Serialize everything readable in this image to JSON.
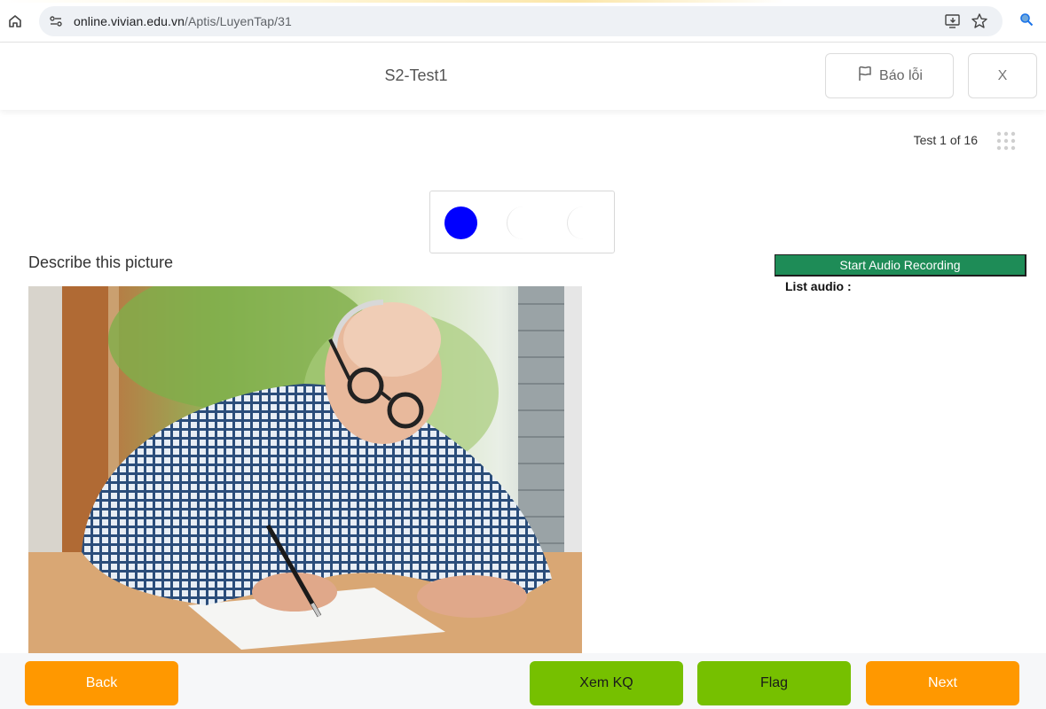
{
  "browser": {
    "url_host": "online.vivian.edu.vn",
    "url_path": "/Aptis/LuyenTap/31"
  },
  "header": {
    "title": "S2-Test1",
    "report_label": "Báo lỗi",
    "close_label": "X"
  },
  "test": {
    "counter_text": "Test 1 of 16"
  },
  "progress": {
    "total_dots": 3,
    "active_index": 0,
    "active_color": "#0000ff"
  },
  "question": {
    "text": "Describe this picture",
    "image": "man-writing-at-table"
  },
  "recording": {
    "button_label": "Start Audio Recording",
    "button_color": "#1e8c57",
    "list_label": "List audio :"
  },
  "footer": {
    "back_label": "Back",
    "result_label": "Xem KQ",
    "flag_label": "Flag",
    "next_label": "Next"
  },
  "colors": {
    "orange": "#ff9800",
    "green": "#76c000"
  }
}
